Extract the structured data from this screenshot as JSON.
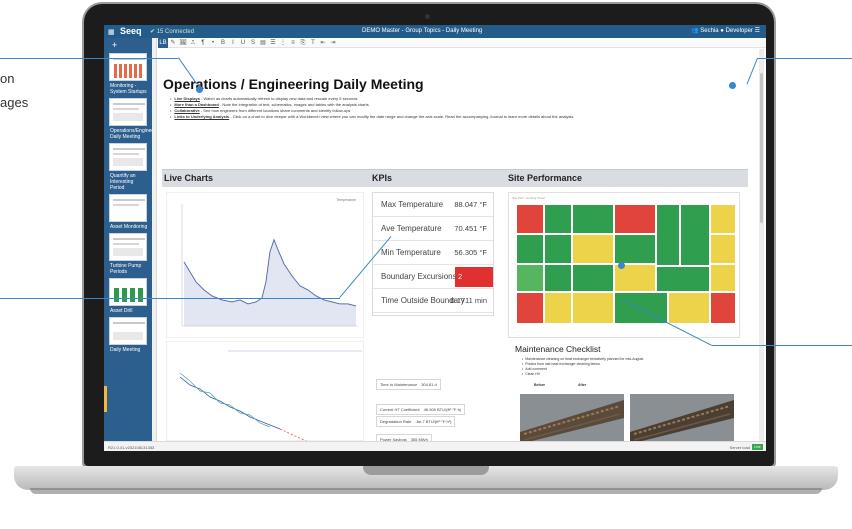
{
  "app": {
    "logo": "Seeq",
    "connection": "15 Connected",
    "window_title": "DEMO Master - Group Topics - Daily Meeting",
    "user": "Sechia",
    "menu": "Developer"
  },
  "toolbar": [
    "LB",
    "✎",
    "🖼",
    "⎍",
    "¶",
    "•",
    "B",
    "I",
    "U",
    "S",
    "▤",
    "☰",
    "⋮",
    "≡",
    "⎘",
    "T",
    "⇤",
    "⇥"
  ],
  "sidebar": {
    "items": [
      {
        "label": "Monitoring - System Startups",
        "selected": false
      },
      {
        "label": "Operations/Engineering Daily Meeting",
        "selected": false
      },
      {
        "label": "Quantify an Interesting Period",
        "selected": false
      },
      {
        "label": "Asset Monitoring",
        "selected": false
      },
      {
        "label": "Turbine Pump Periods",
        "selected": false
      },
      {
        "label": "Asset Drill",
        "selected": false
      },
      {
        "label": "Daily Meeting",
        "selected": true
      }
    ]
  },
  "document": {
    "title": "Operations / Engineering Daily Meeting",
    "bullets": [
      {
        "lead": "Live Displays",
        "text": " - Watch as charts automatically refresh to display new data and rescale every 5 seconds"
      },
      {
        "lead": "More than a Dashboard",
        "text": " - Note the integration of text, schematics, images and tables with the analysis charts"
      },
      {
        "lead": "Collaborative",
        "text": " - See how engineers from different locations share comments and identify follow-ups"
      },
      {
        "lead": "Links to Underlying Analysis",
        "text": " - Click on a chart to dive deeper with a Workbench view where you can modify the date range and change the axis scale. Read the accompanying Journal to learn more details about the analysis."
      }
    ],
    "sections": {
      "live_charts": "Live Charts",
      "kpis": "KPIs",
      "site_performance": "Site Performance"
    },
    "kpis": [
      {
        "label": "Max Temperature",
        "value": "88.047 °F",
        "alert": false
      },
      {
        "label": "Ave Temperature",
        "value": "70.451 °F",
        "alert": false
      },
      {
        "label": "Min Temperature",
        "value": "56.305 °F",
        "alert": false
      },
      {
        "label": "Boundary Excursions",
        "value": "2",
        "alert": true
      },
      {
        "label": "Time Outside Boundary",
        "value": "0.1711 min",
        "alert": false
      }
    ],
    "trend_legend": "Temperature",
    "heatmap_caption": "Site Perf - Cooling Tower",
    "lower_kpis": [
      {
        "label": "Time to Maintenance",
        "value": "304.81 d",
        "alert": false
      },
      {
        "label": "Current HT Coefficient",
        "value": "46.909 BTU/(ft²·°F·h)",
        "alert": false
      },
      {
        "label": "Degradation Rate",
        "value": "-6e-7 BTU/(ft²·°F·h²)",
        "alert": false
      },
      {
        "label": "Power Savings",
        "value": "355 MWh",
        "alert": false
      },
      {
        "label": "Monetary Savings",
        "value": "$61K",
        "alert": true
      }
    ],
    "maintenance": {
      "title": "Maintenance Checklist",
      "items": [
        "Maintenance cleaning on heat exchanger tentatively planned for mid-August.",
        "Photos from last heat exchanger cleaning below.",
        "Add comment",
        "Clean HX"
      ],
      "before": "Before",
      "after": "After"
    }
  },
  "statusbar": {
    "left": "R21.0.41-v202108131353",
    "right": "Server load",
    "live": "Live"
  },
  "colors": {
    "brand": "#235b8a",
    "sidebar": "#2d5f8e",
    "alert": "#e03030",
    "callout": "#3a86c8"
  },
  "callouts": {
    "left_text_1": "on",
    "left_text_2": "ages"
  }
}
